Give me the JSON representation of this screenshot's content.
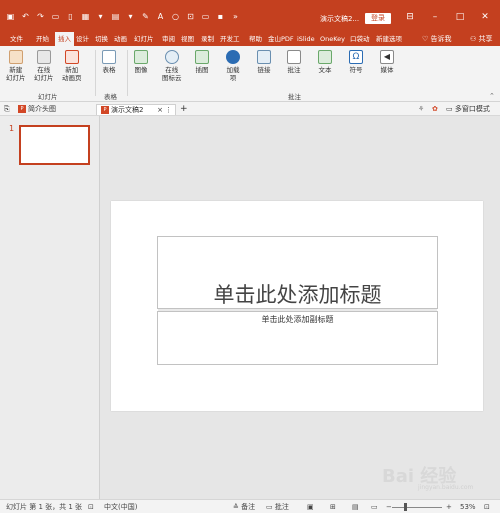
{
  "title_bar": {
    "doc_title": "演示文稿2...",
    "login_label": "登录",
    "quick_access_icons": [
      "save-icon",
      "undo-icon",
      "redo-icon",
      "slideshow-icon",
      "new-doc-icon"
    ],
    "window_controls": [
      "ribbon-display-icon",
      "minimize-icon",
      "maximize-icon",
      "close-icon"
    ]
  },
  "tabs": [
    {
      "label": "文件",
      "active": false
    },
    {
      "label": "开始",
      "active": false
    },
    {
      "label": "插入",
      "active": true
    },
    {
      "label": "设计",
      "active": false
    },
    {
      "label": "切换",
      "active": false
    },
    {
      "label": "动画",
      "active": false
    },
    {
      "label": "幻灯片",
      "active": false
    },
    {
      "label": "审阅",
      "active": false
    },
    {
      "label": "视图",
      "active": false
    },
    {
      "label": "录制",
      "active": false
    },
    {
      "label": "开发工",
      "active": false
    },
    {
      "label": "帮助",
      "active": false
    },
    {
      "label": "金山PDF",
      "active": false
    },
    {
      "label": "iSlide",
      "active": false
    },
    {
      "label": "OneKey",
      "active": false
    },
    {
      "label": "口袋动",
      "active": false
    },
    {
      "label": "新建选项",
      "active": false
    }
  ],
  "tell_me": "告诉我",
  "share": "共享",
  "ribbon": {
    "new_slide": "新建\n幻灯片",
    "online_slide": "在线\n幻灯片",
    "new_animated_page": "新加\n动画页",
    "group_slides": "幻灯片",
    "table": "表格",
    "group_table": "表格",
    "image": "图像",
    "online_icons": "在线\n图标云",
    "illustrations": "插图",
    "addins": "加载\n项",
    "links": "链接",
    "comment": "批注",
    "group_comment": "批注",
    "text": "文本",
    "symbols": "符号",
    "media": "媒体"
  },
  "doc_tabs": [
    {
      "label": "简介头图",
      "active": false
    },
    {
      "label": "演示文稿2",
      "active": true
    }
  ],
  "doc_tab_extras": {
    "close": "×",
    "menu": "⋮",
    "add": "+",
    "multi_window": "多窗口模式"
  },
  "thumbnails": [
    {
      "number": "1"
    }
  ],
  "slide": {
    "title_placeholder": "单击此处添加标题",
    "subtitle_placeholder": "单击此处添加副标题"
  },
  "status_bar": {
    "slide_info": "幻灯片 第 1 张，共 1 张",
    "language": "中文(中国)",
    "notes": "备注",
    "comments": "批注",
    "zoom": "53%",
    "zoom_minus": "−",
    "zoom_plus": "+",
    "zoom_fraction": 0.53
  },
  "watermark": {
    "text": "Bai 经验",
    "sub": "jingyan.baidu.com"
  },
  "colors": {
    "accent": "#c4401f",
    "ribbon_bg": "#f3f3f3",
    "canvas_bg": "#e6e6e6"
  }
}
